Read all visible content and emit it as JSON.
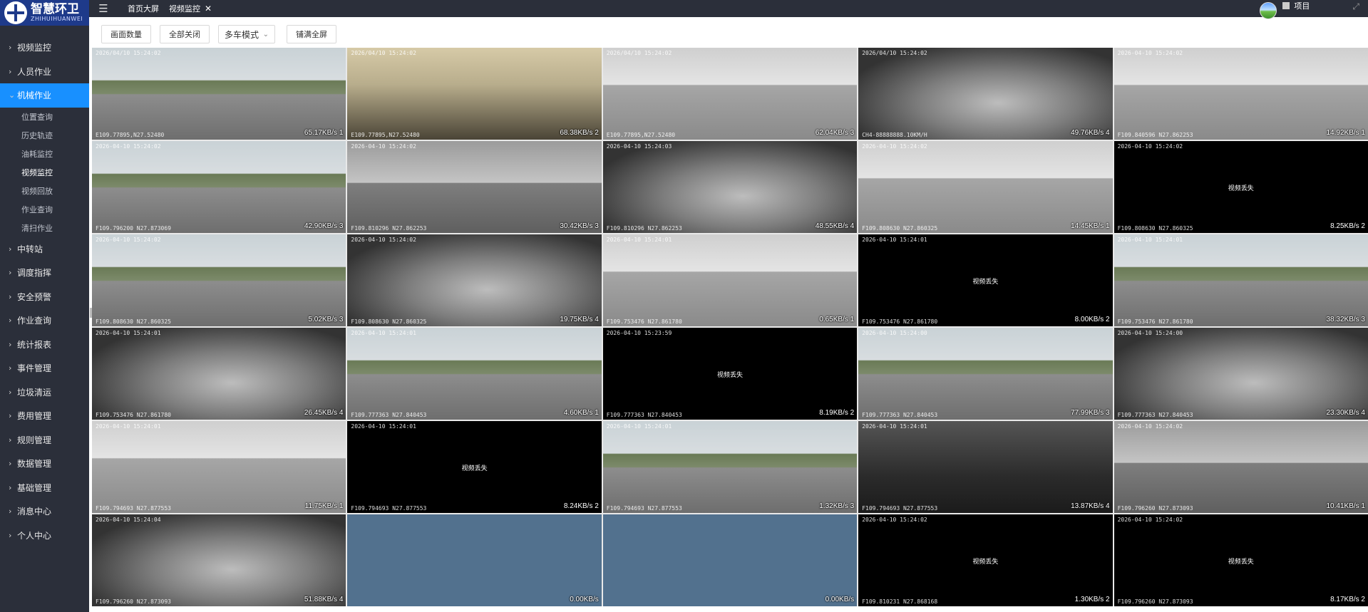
{
  "brand": {
    "name_cn": "智慧环卫",
    "name_en": "ZHIHUIHUANWEI"
  },
  "sidebar": {
    "items": [
      {
        "label": "视频监控",
        "active": false
      },
      {
        "label": "人员作业",
        "active": false
      },
      {
        "label": "机械作业",
        "active": true,
        "children": [
          "位置查询",
          "历史轨迹",
          "油耗监控",
          "视频监控",
          "视频回放",
          "作业查询",
          "清扫作业"
        ],
        "active_child": 3
      },
      {
        "label": "中转站",
        "active": false
      },
      {
        "label": "调度指挥",
        "active": false
      },
      {
        "label": "安全预警",
        "active": false
      },
      {
        "label": "作业查询",
        "active": false
      },
      {
        "label": "统计报表",
        "active": false
      },
      {
        "label": "事件管理",
        "active": false
      },
      {
        "label": "垃圾清运",
        "active": false
      },
      {
        "label": "费用管理",
        "active": false
      },
      {
        "label": "规则管理",
        "active": false
      },
      {
        "label": "数据管理",
        "active": false
      },
      {
        "label": "基础管理",
        "active": false
      },
      {
        "label": "消息中心",
        "active": false
      },
      {
        "label": "个人中心",
        "active": false
      }
    ]
  },
  "topbar": {
    "tabs": [
      {
        "label": "首页大屏",
        "closable": false
      },
      {
        "label": "视频监控",
        "closable": true
      }
    ],
    "close_glyph": "✕",
    "project_label": "项目"
  },
  "toolbar": {
    "screen_count": "画面数量",
    "close_all": "全部关闭",
    "mode_value": "多车模式",
    "fill_screen": "铺满全屏"
  },
  "colors": {
    "accent": "#1890ff",
    "sidebar_bg": "#2b2f3a",
    "logo_bg": "#1e3a8a",
    "empty_cell": "#52718e"
  },
  "video_cells": [
    {
      "tone": "t-street",
      "timestamp": "2026/04/10 15:24:02",
      "gps": "E109.77895,N27.52480",
      "center": "",
      "rate": "65.17KB/s 1"
    },
    {
      "tone": "t-warm",
      "timestamp": "2026/04/10 15:24:02",
      "gps": "E109.77895,N27.52480",
      "center": "",
      "rate": "68.38KB/s 2"
    },
    {
      "tone": "t-light",
      "timestamp": "2026/04/10 15:24:02",
      "gps": "E109.77895,N27.52480",
      "center": "",
      "rate": "62.04KB/s 3"
    },
    {
      "tone": "t-cab",
      "timestamp": "2026/04/10 15:24:02",
      "gps": "CH4-88888888.10KM/H",
      "center": "",
      "rate": "49.76KB/s 4"
    },
    {
      "tone": "t-light",
      "timestamp": "2026-04-10 15:24:02",
      "gps": "F109.840596 N27.862253",
      "center": "",
      "rate": "14.92KB/s 1"
    },
    {
      "tone": "t-street",
      "timestamp": "2026-04-10 15:24:02",
      "gps": "F109.796200 N27.873069",
      "center": "",
      "rate": "42.90KB/s 3"
    },
    {
      "tone": "t-gray",
      "timestamp": "2026-04-10 15:24:02",
      "gps": "F109.810296 N27.862253",
      "center": "",
      "rate": "30.42KB/s 3"
    },
    {
      "tone": "t-cab",
      "timestamp": "2026-04-10 15:24:03",
      "gps": "F109.810296 N27.862253",
      "center": "",
      "rate": "48.55KB/s 4"
    },
    {
      "tone": "t-light",
      "timestamp": "2026-04-10 15:24:02",
      "gps": "F109.808630 N27.860325",
      "center": "",
      "rate": "14.45KB/s 1"
    },
    {
      "tone": "t-black",
      "timestamp": "2026-04-10 15:24:02",
      "gps": "F109.808630 N27.860325",
      "center": "视频丢失",
      "rate": "8.25KB/s 2"
    },
    {
      "tone": "t-street",
      "timestamp": "2026-04-10 15:24:02",
      "gps": "F109.808630 N27.860325",
      "center": "",
      "rate": "5.02KB/s 3"
    },
    {
      "tone": "t-cab",
      "timestamp": "2026-04-10 15:24:02",
      "gps": "F109.808630 N27.860325",
      "center": "",
      "rate": "19.75KB/s 4"
    },
    {
      "tone": "t-light",
      "timestamp": "2026-04-10 15:24:01",
      "gps": "F109.753476 N27.861780",
      "center": "",
      "rate": "0.65KB/s 1"
    },
    {
      "tone": "t-black",
      "timestamp": "2026-04-10 15:24:01",
      "gps": "F109.753476 N27.861780",
      "center": "视频丢失",
      "rate": "8.00KB/s 2"
    },
    {
      "tone": "t-street",
      "timestamp": "2026-04-10 15:24:01",
      "gps": "F109.753476 N27.861780",
      "center": "",
      "rate": "38.32KB/s 3"
    },
    {
      "tone": "t-cab",
      "timestamp": "2026-04-10 15:24:01",
      "gps": "F109.753476 N27.861780",
      "center": "",
      "rate": "26.45KB/s 4"
    },
    {
      "tone": "t-street",
      "timestamp": "2026-04-10 15:24:01",
      "gps": "F109.777363 N27.840453",
      "center": "",
      "rate": "4.60KB/s 1"
    },
    {
      "tone": "t-black",
      "timestamp": "2026-04-10 15:23:59",
      "gps": "F109.777363 N27.840453",
      "center": "视频丢失",
      "rate": "8.19KB/s 2"
    },
    {
      "tone": "t-street",
      "timestamp": "2026-04-10 15:24:00",
      "gps": "F109.777363 N27.840453",
      "center": "",
      "rate": "77.99KB/s 3"
    },
    {
      "tone": "t-cab",
      "timestamp": "2026-04-10 15:24:00",
      "gps": "F109.777363 N27.840453",
      "center": "",
      "rate": "23.30KB/s 4"
    },
    {
      "tone": "t-light",
      "timestamp": "2026-04-10 15:24:01",
      "gps": "F109.794693 N27.877553",
      "center": "",
      "rate": "11.75KB/s 1"
    },
    {
      "tone": "t-black",
      "timestamp": "2026-04-10 15:24:01",
      "gps": "F109.794693 N27.877553",
      "center": "视频丢失",
      "rate": "8.24KB/s 2"
    },
    {
      "tone": "t-street",
      "timestamp": "2026-04-10 15:24:01",
      "gps": "F109.794693 N27.877553",
      "center": "",
      "rate": "1.32KB/s 3"
    },
    {
      "tone": "t-dark",
      "timestamp": "2026-04-10 15:24:01",
      "gps": "F109.794693 N27.877553",
      "center": "",
      "rate": "13.87KB/s 4"
    },
    {
      "tone": "t-gray",
      "timestamp": "2026-04-10 15:24:02",
      "gps": "F109.796260 N27.873093",
      "center": "",
      "rate": "10.41KB/s 1"
    },
    {
      "tone": "t-cab",
      "timestamp": "2026-04-10 15:24:04",
      "gps": "F109.796260 N27.873093",
      "center": "",
      "rate": "51.88KB/s 4"
    },
    {
      "tone": "t-blue",
      "timestamp": "",
      "gps": "",
      "center": "",
      "rate": "0.00KB/s"
    },
    {
      "tone": "t-blue",
      "timestamp": "",
      "gps": "",
      "center": "",
      "rate": "0.00KB/s"
    },
    {
      "tone": "t-black",
      "timestamp": "2026-04-10 15:24:02",
      "gps": "F109.810231 N27.868168",
      "center": "视频丢失",
      "rate": "1.30KB/s 2"
    },
    {
      "tone": "t-black",
      "timestamp": "2026-04-10 15:24:02",
      "gps": "F109.796260 N27.873093",
      "center": "视频丢失",
      "rate": "8.17KB/s 2"
    }
  ]
}
